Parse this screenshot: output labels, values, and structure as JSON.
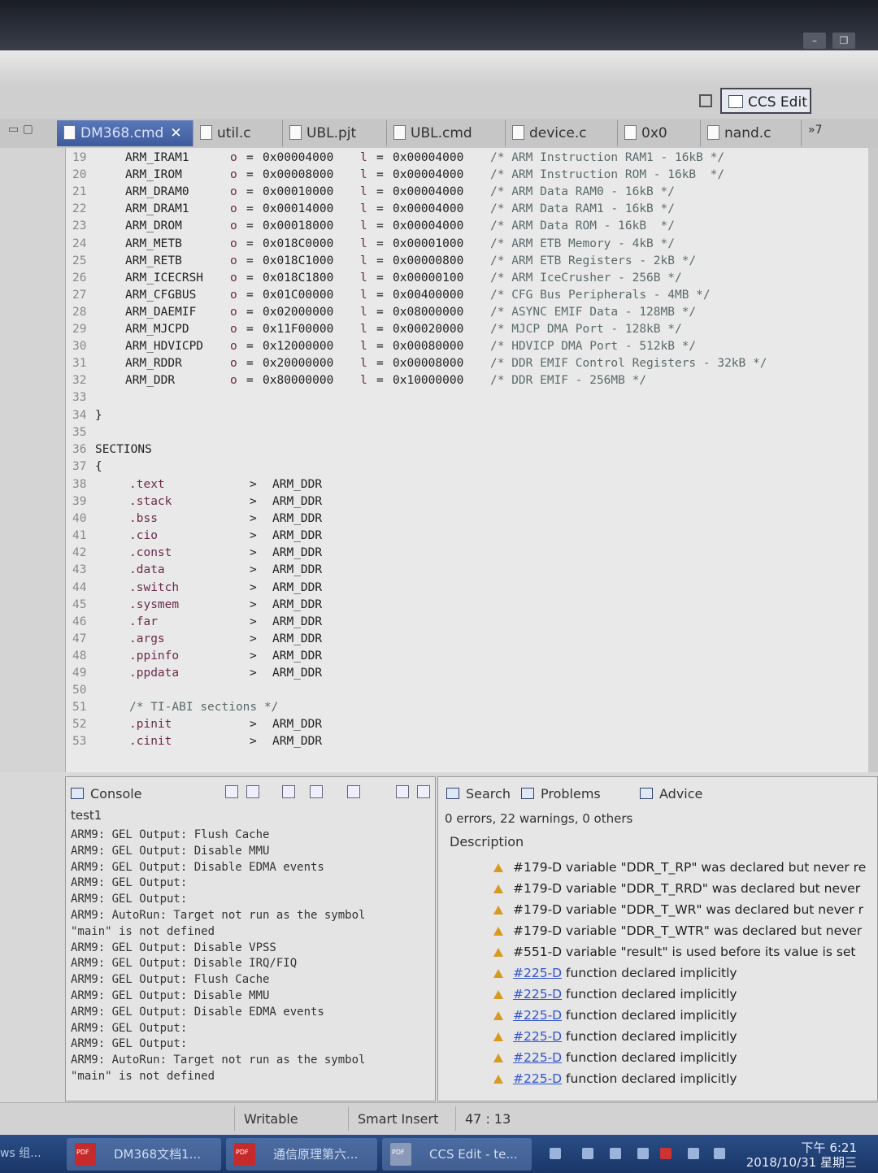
{
  "perspective": {
    "label": "CCS Edit"
  },
  "tabs": [
    {
      "label": "DM368.cmd",
      "active": true,
      "close": "✕"
    },
    {
      "label": "util.c"
    },
    {
      "label": "UBL.pjt"
    },
    {
      "label": "UBL.cmd"
    },
    {
      "label": "device.c"
    },
    {
      "label": "0x0"
    },
    {
      "label": "nand.c"
    }
  ],
  "tabs_overflow": "»7",
  "memory_rows": [
    {
      "ln": "19",
      "name": "ARM_IRAM1",
      "org": "o",
      "origin": "0x00004000",
      "len_kw": "l",
      "length": "0x00004000",
      "comment": "/* ARM Instruction RAM1 - 16kB */"
    },
    {
      "ln": "20",
      "name": "ARM_IROM",
      "org": "o",
      "origin": "0x00008000",
      "len_kw": "l",
      "length": "0x00004000",
      "comment": "/* ARM Instruction ROM - 16kB  */"
    },
    {
      "ln": "21",
      "name": "ARM_DRAM0",
      "org": "o",
      "origin": "0x00010000",
      "len_kw": "l",
      "length": "0x00004000",
      "comment": "/* ARM Data RAM0 - 16kB */"
    },
    {
      "ln": "22",
      "name": "ARM_DRAM1",
      "org": "o",
      "origin": "0x00014000",
      "len_kw": "l",
      "length": "0x00004000",
      "comment": "/* ARM Data RAM1 - 16kB */"
    },
    {
      "ln": "23",
      "name": "ARM_DROM",
      "org": "o",
      "origin": "0x00018000",
      "len_kw": "l",
      "length": "0x00004000",
      "comment": "/* ARM Data ROM - 16kB  */"
    },
    {
      "ln": "24",
      "name": "ARM_METB",
      "org": "o",
      "origin": "0x018C0000",
      "len_kw": "l",
      "length": "0x00001000",
      "comment": "/* ARM ETB Memory - 4kB */"
    },
    {
      "ln": "25",
      "name": "ARM_RETB",
      "org": "o",
      "origin": "0x018C1000",
      "len_kw": "l",
      "length": "0x00000800",
      "comment": "/* ARM ETB Registers - 2kB */"
    },
    {
      "ln": "26",
      "name": "ARM_ICECRSH",
      "org": "o",
      "origin": "0x018C1800",
      "len_kw": "l",
      "length": "0x00000100",
      "comment": "/* ARM IceCrusher - 256B */"
    },
    {
      "ln": "27",
      "name": "ARM_CFGBUS",
      "org": "o",
      "origin": "0x01C00000",
      "len_kw": "l",
      "length": "0x00400000",
      "comment": "/* CFG Bus Peripherals - 4MB */"
    },
    {
      "ln": "28",
      "name": "ARM_DAEMIF",
      "org": "o",
      "origin": "0x02000000",
      "len_kw": "l",
      "length": "0x08000000",
      "comment": "/* ASYNC EMIF Data - 128MB */"
    },
    {
      "ln": "29",
      "name": "ARM_MJCPD",
      "org": "o",
      "origin": "0x11F00000",
      "len_kw": "l",
      "length": "0x00020000",
      "comment": "/* MJCP DMA Port - 128kB */"
    },
    {
      "ln": "30",
      "name": "ARM_HDVICPD",
      "org": "o",
      "origin": "0x12000000",
      "len_kw": "l",
      "length": "0x00080000",
      "comment": "/* HDVICP DMA Port - 512kB */"
    },
    {
      "ln": "31",
      "name": "ARM_RDDR",
      "org": "o",
      "origin": "0x20000000",
      "len_kw": "l",
      "length": "0x00008000",
      "comment": "/* DDR EMIF Control Registers - 32kB */"
    },
    {
      "ln": "32",
      "name": "ARM_DDR",
      "org": "o",
      "origin": "0x80000000",
      "len_kw": "l",
      "length": "0x10000000",
      "comment": "/* DDR EMIF - 256MB */"
    }
  ],
  "misc_lines": [
    {
      "ln": "33",
      "text": ""
    },
    {
      "ln": "34",
      "text": "}"
    },
    {
      "ln": "35",
      "text": ""
    },
    {
      "ln": "36",
      "text": "SECTIONS"
    },
    {
      "ln": "37",
      "text": "{"
    }
  ],
  "section_rows": [
    {
      "ln": "38",
      "name": ".text",
      "target": "ARM_DDR"
    },
    {
      "ln": "39",
      "name": ".stack",
      "target": "ARM_DDR"
    },
    {
      "ln": "40",
      "name": ".bss",
      "target": "ARM_DDR"
    },
    {
      "ln": "41",
      "name": ".cio",
      "target": "ARM_DDR"
    },
    {
      "ln": "42",
      "name": ".const",
      "target": "ARM_DDR"
    },
    {
      "ln": "43",
      "name": ".data",
      "target": "ARM_DDR"
    },
    {
      "ln": "44",
      "name": ".switch",
      "target": "ARM_DDR"
    },
    {
      "ln": "45",
      "name": ".sysmem",
      "target": "ARM_DDR"
    },
    {
      "ln": "46",
      "name": ".far",
      "target": "ARM_DDR"
    },
    {
      "ln": "47",
      "name": ".args",
      "target": "ARM_DDR"
    },
    {
      "ln": "48",
      "name": ".ppinfo",
      "target": "ARM_DDR"
    },
    {
      "ln": "49",
      "name": ".ppdata",
      "target": "ARM_DDR"
    }
  ],
  "blank_line": {
    "ln": "50"
  },
  "abi_comment": {
    "ln": "51",
    "text": "/* TI-ABI sections */"
  },
  "abi_rows": [
    {
      "ln": "52",
      "name": ".pinit",
      "target": "ARM_DDR"
    },
    {
      "ln": "53",
      "name": ".cinit",
      "target": "ARM_DDR"
    }
  ],
  "console": {
    "title": "Console",
    "name": "test1",
    "lines": [
      "ARM9: GEL Output: Flush Cache",
      "ARM9: GEL Output: Disable MMU",
      "ARM9: GEL Output: Disable EDMA events",
      "ARM9: GEL Output:",
      "ARM9: GEL Output:",
      "ARM9: AutoRun: Target not run as the symbol",
      "\"main\" is not defined",
      "ARM9: GEL Output: Disable VPSS",
      "ARM9: GEL Output: Disable IRQ/FIQ",
      "ARM9: GEL Output: Flush Cache",
      "ARM9: GEL Output: Disable MMU",
      "ARM9: GEL Output: Disable EDMA events",
      "ARM9: GEL Output:",
      "ARM9: GEL Output:",
      "ARM9: AutoRun: Target not run as the symbol",
      "\"main\" is not defined"
    ]
  },
  "problems": {
    "tab_search": "Search",
    "tab_problems": "Problems",
    "tab_advice": "Advice",
    "summary": "0 errors, 22 warnings, 0 others",
    "column": "Description",
    "items": [
      {
        "code": "#179-D",
        "text": "variable \"DDR_T_RP\" was declared but never re"
      },
      {
        "code": "#179-D",
        "text": "variable \"DDR_T_RRD\" was declared but never"
      },
      {
        "code": "#179-D",
        "text": "variable \"DDR_T_WR\" was declared but never r"
      },
      {
        "code": "#179-D",
        "text": "variable \"DDR_T_WTR\" was declared but never"
      },
      {
        "code": "#551-D",
        "text": "variable \"result\" is used before its value is set"
      },
      {
        "code": "#225-D",
        "text": "function declared implicitly",
        "link": true
      },
      {
        "code": "#225-D",
        "text": "function declared implicitly",
        "link": true
      },
      {
        "code": "#225-D",
        "text": "function declared implicitly",
        "link": true
      },
      {
        "code": "#225-D",
        "text": "function declared implicitly",
        "link": true
      },
      {
        "code": "#225-D",
        "text": "function declared implicitly",
        "link": true
      },
      {
        "code": "#225-D",
        "text": "function declared implicitly",
        "link": true
      }
    ]
  },
  "status": {
    "mode": "Writable",
    "insert": "Smart Insert",
    "position": "47 : 13"
  },
  "taskbar": {
    "start_fragment": "ws 组...",
    "items": [
      "DM368文档1...",
      "通信原理第六...",
      "CCS Edit - te..."
    ],
    "time": "下午 6:21",
    "date": "2018/10/31 星期三"
  },
  "colors": {
    "active_tab": "#3d5a9e",
    "warning": "#d79a20",
    "link": "#3355cc",
    "taskbar": "#1a3668"
  }
}
